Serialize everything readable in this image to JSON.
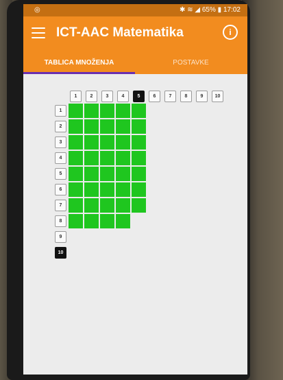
{
  "status_bar": {
    "left_icon": "circle-icon",
    "battery": "65%",
    "time": "17:02"
  },
  "app": {
    "title": "ICT-AAC Matematika"
  },
  "tabs": [
    {
      "label": "TABLICA MNOŽENJA",
      "active": true
    },
    {
      "label": "POSTAVKE",
      "active": false
    }
  ],
  "table": {
    "columns": [
      "1",
      "2",
      "3",
      "4",
      "5",
      "6",
      "7",
      "8",
      "9",
      "10"
    ],
    "rows": [
      "1",
      "2",
      "3",
      "4",
      "5",
      "6",
      "7",
      "8",
      "9",
      "10"
    ],
    "selected_column": "5",
    "selected_row": "10",
    "filled_cells": [
      [
        1,
        2,
        3,
        4,
        5
      ],
      [
        1,
        2,
        3,
        4,
        5
      ],
      [
        1,
        2,
        3,
        4,
        5
      ],
      [
        1,
        2,
        3,
        4,
        5
      ],
      [
        1,
        2,
        3,
        4,
        5
      ],
      [
        1,
        2,
        3,
        4,
        5
      ],
      [
        1,
        2,
        3,
        4,
        5
      ],
      [
        1,
        2,
        3,
        4
      ],
      [],
      []
    ],
    "fill_color": "#1fc61f"
  },
  "colors": {
    "app_bar": "#f28c1f",
    "tab_indicator": "#6a2fb0"
  }
}
